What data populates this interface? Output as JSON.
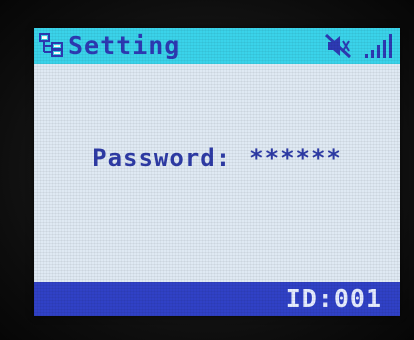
{
  "header": {
    "title": "Setting",
    "settings_icon": "network-settings-icon",
    "mute_icon": "speaker-muted-icon",
    "signal_icon": "signal-strength-icon",
    "signal_bars": 5,
    "background_color": "#3ad3ea",
    "text_color": "#2d3ab4"
  },
  "main": {
    "password_label": "Password:",
    "password_value": "******",
    "background_color": "#dfe9f3",
    "text_color": "#2e3ba6"
  },
  "footer": {
    "device_id": "ID:001",
    "background_color": "#3041c6",
    "text_color": "#e6ecff"
  }
}
